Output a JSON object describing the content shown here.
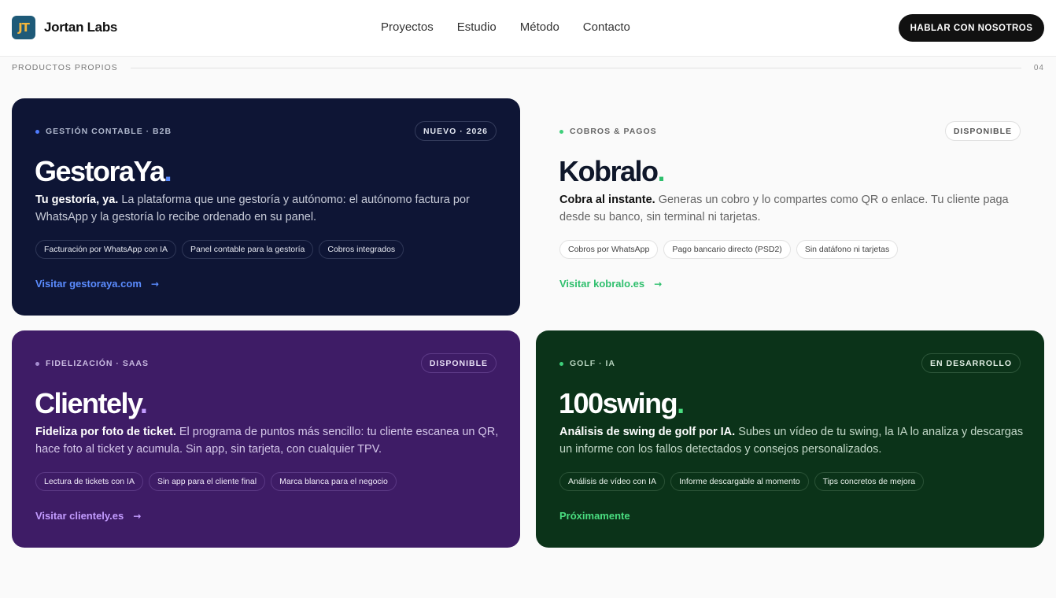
{
  "header": {
    "logo_mark": "JT",
    "brand": "Jortan Labs",
    "nav": [
      "Proyectos",
      "Estudio",
      "Método",
      "Contacto"
    ],
    "cta": "HABLAR CON NOSOTROS"
  },
  "section": {
    "label": "PRODUCTOS PROPIOS",
    "number": "04"
  },
  "colors": {
    "gestoraya_bg": "#0e1535",
    "clientely_bg": "#3e1c66",
    "swing_bg": "#0b3319",
    "gestoraya_accent": "#5b8cff",
    "kobralo_accent": "#2fbf6d",
    "clientely_accent": "#c39cff",
    "swing_accent": "#4ade80"
  },
  "products": [
    {
      "category": "GESTIÓN CONTABLE · B2B",
      "badge": "NUEVO · 2026",
      "name": "GestoraYa",
      "dot": ".",
      "lead": "Tu gestoría, ya.",
      "description": " La plataforma que une gestoría y autónomo: el autónomo factura por WhatsApp y la gestoría lo recibe ordenado en su panel.",
      "tags": [
        "Facturación por WhatsApp con IA",
        "Panel contable para la gestoría",
        "Cobros integrados"
      ],
      "link": "Visitar gestoraya.com",
      "arrow": "→"
    },
    {
      "category": "COBROS & PAGOS",
      "badge": "DISPONIBLE",
      "name": "Kobralo",
      "dot": ".",
      "lead": "Cobra al instante.",
      "description": " Generas un cobro y lo compartes como QR o enlace. Tu cliente paga desde su banco, sin terminal ni tarjetas.",
      "tags": [
        "Cobros por WhatsApp",
        "Pago bancario directo (PSD2)",
        "Sin datáfono ni tarjetas"
      ],
      "link": "Visitar kobralo.es",
      "arrow": "→"
    },
    {
      "category": "FIDELIZACIÓN · SAAS",
      "badge": "DISPONIBLE",
      "name": "Clientely",
      "dot": ".",
      "lead": "Fideliza por foto de ticket.",
      "description": " El programa de puntos más sencillo: tu cliente escanea un QR, hace foto al ticket y acumula. Sin app, sin tarjeta, con cualquier TPV.",
      "tags": [
        "Lectura de tickets con IA",
        "Sin app para el cliente final",
        "Marca blanca para el negocio"
      ],
      "link": "Visitar clientely.es",
      "arrow": "→"
    },
    {
      "category": "GOLF · IA",
      "badge": "EN DESARROLLO",
      "name": "100swing",
      "dot": ".",
      "lead": "Análisis de swing de golf por IA.",
      "description": " Subes un vídeo de tu swing, la IA lo analiza y descargas un informe con los fallos detectados y consejos personalizados.",
      "tags": [
        "Análisis de vídeo con IA",
        "Informe descargable al momento",
        "Tips concretos de mejora"
      ],
      "link": "Próximamente",
      "arrow": ""
    }
  ]
}
